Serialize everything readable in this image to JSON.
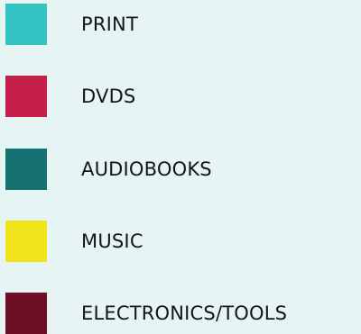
{
  "chart_data": {
    "type": "legend",
    "legend": [
      {
        "label": "PRINT",
        "color": "#33c3c3"
      },
      {
        "label": "DVDS",
        "color": "#c41f48"
      },
      {
        "label": "AUDIOBOOKS",
        "color": "#157172"
      },
      {
        "label": "MUSIC",
        "color": "#f0e21b"
      },
      {
        "label": "ELECTRONICS/TOOLS",
        "color": "#6e0f25"
      }
    ]
  }
}
